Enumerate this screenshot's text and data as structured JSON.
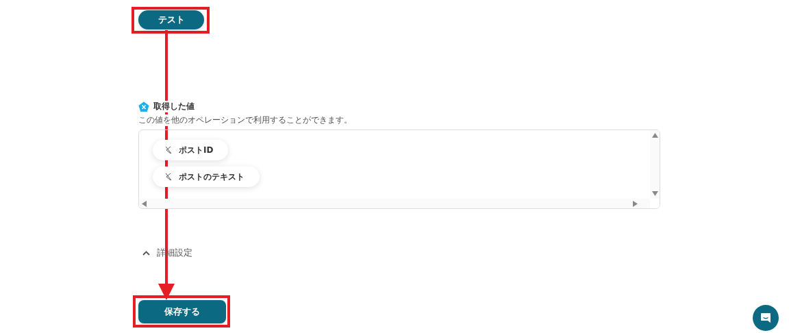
{
  "test_button": "テスト",
  "outputs": {
    "title": "取得した値",
    "description": "この値を他のオペレーションで利用することができます。",
    "items": [
      {
        "label": "ポストID"
      },
      {
        "label": "ポストのテキスト"
      }
    ]
  },
  "advanced_settings": {
    "label": "詳細設定",
    "expanded": true
  },
  "save_button": "保存する"
}
